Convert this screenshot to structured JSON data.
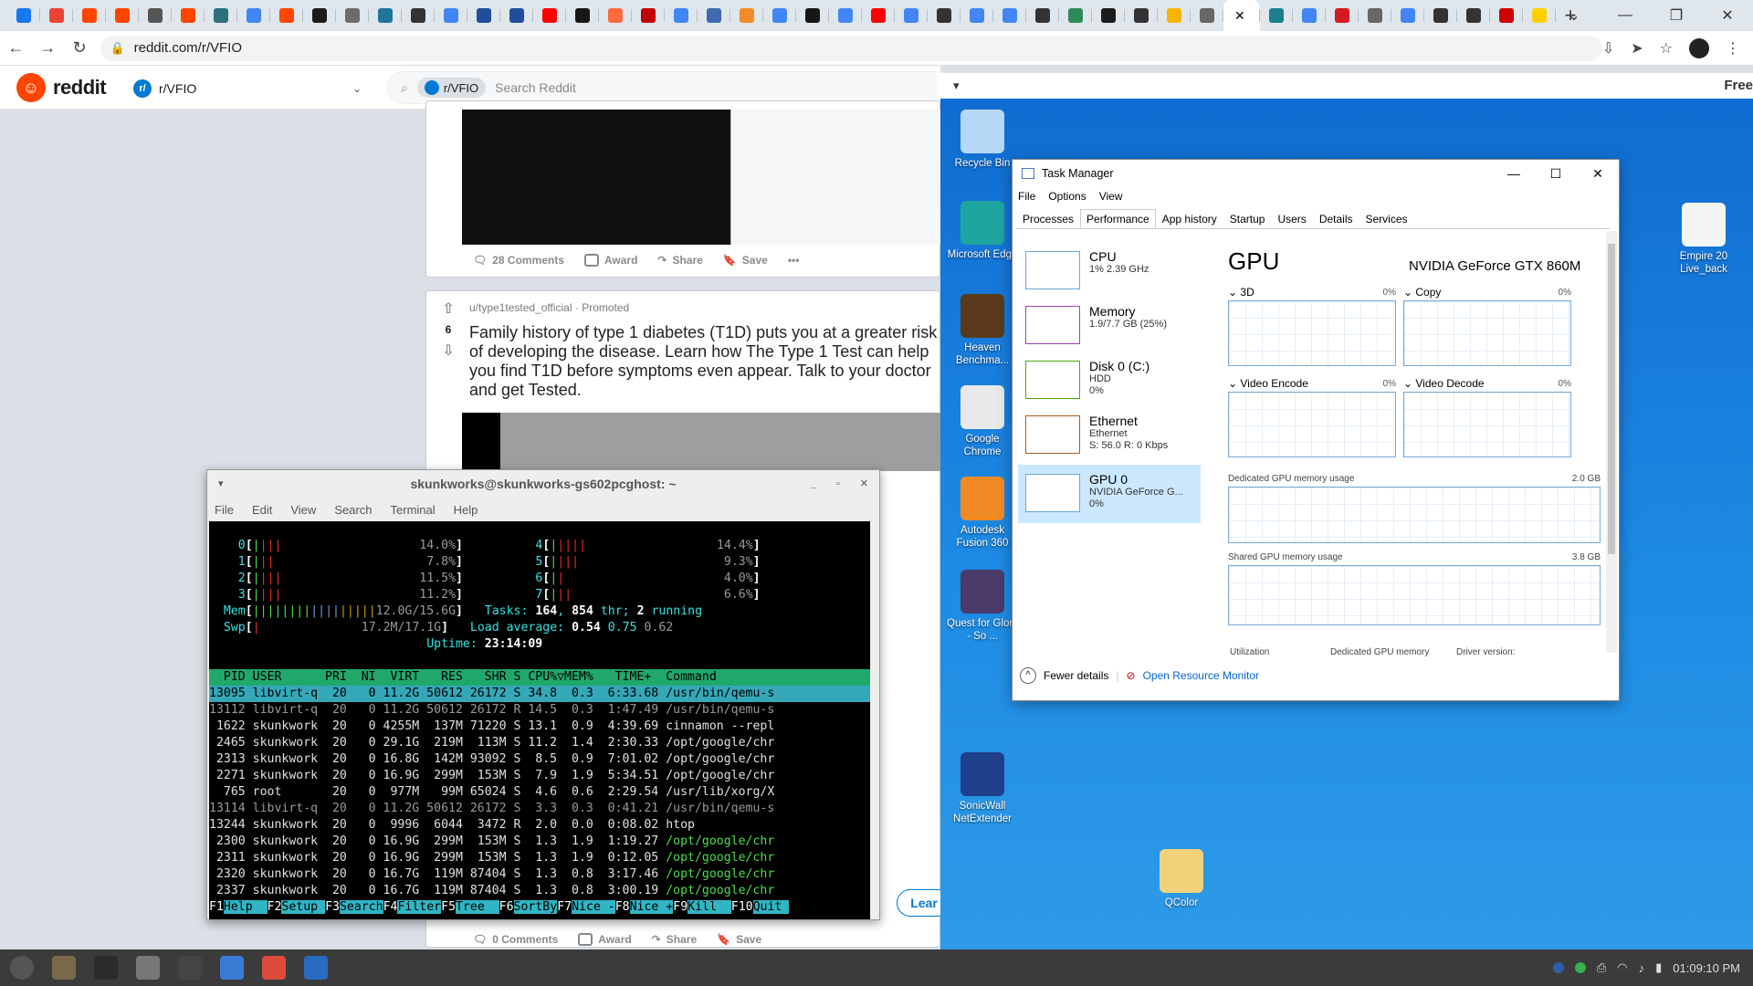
{
  "browser": {
    "tab_favicons": [
      "#1877f2",
      "#ea4335",
      "#ff4500",
      "#ff4500",
      "#555555",
      "#ff4500",
      "#2f6f7a",
      "#4285f4",
      "#ff4500",
      "#1c1c1c",
      "#6c6c6c",
      "#21759b",
      "#333333",
      "#4285f4",
      "#1f4e9c",
      "#1f4e9c",
      "#ff0000",
      "#181717",
      "#ff6a3d",
      "#c00000",
      "#4285f4",
      "#3f6ab1",
      "#f28c28",
      "#4285f4",
      "#181717",
      "#4285f4",
      "#ff0000",
      "#4285f4",
      "#333333",
      "#4285f4",
      "#4285f4",
      "#333333",
      "#2e8b57",
      "#1c1c1c",
      "#333333",
      "#f7b500",
      "#666666",
      "#ffffff",
      "#1a7f8e",
      "#4285f4",
      "#d71920",
      "#666666",
      "#4285f4",
      "#333333",
      "#333333",
      "#d00000",
      "#ffd000"
    ],
    "url": "reddit.com/r/VFIO",
    "new_tab": "+"
  },
  "reddit": {
    "logo_text": "reddit",
    "community": "r/VFIO",
    "search_chip": "r/VFIO",
    "search_placeholder": "Search Reddit",
    "post1": {
      "comments": "28 Comments",
      "award": "Award",
      "share": "Share",
      "save": "Save"
    },
    "post2": {
      "votes": "6",
      "author": "u/type1tested_official",
      "promoted": "Promoted",
      "title": "Family history of type 1 diabetes (T1D) puts you at a greater risk of developing the disease. Learn how The Type 1 Test can help you find T1D before symptoms even appear. Talk to your doctor and get Tested.",
      "learn": "Lear",
      "comments": "0 Comments",
      "award": "Award",
      "share": "Share",
      "save": "Save"
    }
  },
  "vm": {
    "title_right": "Free",
    "desktop_icons": [
      {
        "label": "Recycle Bin",
        "color": "#b6d7f5"
      },
      {
        "label": "Microsoft Edge",
        "color": "#1fa5a0"
      },
      {
        "label": "Heaven Benchma...",
        "color": "#5a3a1a"
      },
      {
        "label": "Google Chrome",
        "color": "#e9e9e9"
      },
      {
        "label": "Autodesk Fusion 360",
        "color": "#f08a24"
      },
      {
        "label": "Quest for Glory - So ...",
        "color": "#4a3b6b"
      },
      {
        "label": "SonicWall NetExtender",
        "color": "#1e3f8a"
      },
      {
        "label": "QColor",
        "color": "#f1d27a"
      },
      {
        "label": "Empire 20 Live_back",
        "color": "#f5f5f5"
      }
    ]
  },
  "taskmanager": {
    "title": "Task Manager",
    "menu": [
      "File",
      "Options",
      "View"
    ],
    "tabs": [
      "Processes",
      "Performance",
      "App history",
      "Startup",
      "Users",
      "Details",
      "Services"
    ],
    "perf_items": [
      {
        "name": "CPU",
        "line1": "1% 2.39 GHz",
        "line2": ""
      },
      {
        "name": "Memory",
        "line1": "1.9/7.7 GB (25%)",
        "line2": ""
      },
      {
        "name": "Disk 0 (C:)",
        "line1": "HDD",
        "line2": "0%"
      },
      {
        "name": "Ethernet",
        "line1": "Ethernet",
        "line2": "S: 56.0  R: 0 Kbps"
      },
      {
        "name": "GPU 0",
        "line1": "NVIDIA GeForce G...",
        "line2": "0%"
      }
    ],
    "gpu_title": "GPU",
    "gpu_model": "NVIDIA GeForce GTX 860M",
    "engines": [
      {
        "name": "3D",
        "pct": "0%"
      },
      {
        "name": "Copy",
        "pct": "0%"
      },
      {
        "name": "Video Encode",
        "pct": "0%"
      },
      {
        "name": "Video Decode",
        "pct": "0%"
      }
    ],
    "dedicated_label": "Dedicated GPU memory usage",
    "dedicated_max": "2.0 GB",
    "shared_label": "Shared GPU memory usage",
    "shared_max": "3.8 GB",
    "bottom_labels": [
      "Utilization",
      "Dedicated GPU memory",
      "Driver version:"
    ],
    "fewer_details": "Fewer details",
    "open_rm": "Open Resource Monitor"
  },
  "terminal": {
    "title": "skunkworks@skunkworks-gs602pcghost: ~",
    "menu": [
      "File",
      "Edit",
      "View",
      "Search",
      "Terminal",
      "Help"
    ],
    "cpus_left": [
      {
        "id": "0",
        "bars": "||||",
        "pct": "14.0%"
      },
      {
        "id": "1",
        "bars": "|||",
        "pct": "7.8%"
      },
      {
        "id": "2",
        "bars": "||||",
        "pct": "11.5%"
      },
      {
        "id": "3",
        "bars": "||||",
        "pct": "11.2%"
      }
    ],
    "cpus_right": [
      {
        "id": "4",
        "bars": "|||||",
        "pct": "14.4%"
      },
      {
        "id": "5",
        "bars": "||||",
        "pct": "9.3%"
      },
      {
        "id": "6",
        "bars": "||",
        "pct": "4.0%"
      },
      {
        "id": "7",
        "bars": "|||",
        "pct": "6.6%"
      }
    ],
    "mem": "12.0G/15.6G",
    "swp": "17.2M/17.1G",
    "tasks": "164",
    "thr": "854",
    "running": "2",
    "load1": "0.54",
    "load5": "0.75",
    "load15": "0.62",
    "uptime": "23:14:09",
    "header": "  PID USER      PRI  NI  VIRT   RES   SHR S CPU%▽MEM%   TIME+  Command",
    "rows": [
      "13095 libvirt-q  20   0 11.2G 50612 26172 S 34.8  0.3  6:33.68 /usr/bin/qemu-s",
      "13112 libvirt-q  20   0 11.2G 50612 26172 R 14.5  0.3  1:47.49 /usr/bin/qemu-s",
      " 1622 skunkwork  20   0 4255M  137M 71220 S 13.1  0.9  4:39.69 cinnamon --repl",
      " 2465 skunkwork  20   0 29.1G  219M  113M S 11.2  1.4  2:30.33 /opt/google/chr",
      " 2313 skunkwork  20   0 16.8G  142M 93092 S  8.5  0.9  7:01.02 /opt/google/chr",
      " 2271 skunkwork  20   0 16.9G  299M  153M S  7.9  1.9  5:34.51 /opt/google/chr",
      "  765 root       20   0  977M   99M 65024 S  4.6  0.6  2:29.54 /usr/lib/xorg/X",
      "13114 libvirt-q  20   0 11.2G 50612 26172 S  3.3  0.3  0:41.21 /usr/bin/qemu-s",
      "13244 skunkwork  20   0  9996  6044  3472 R  2.0  0.0  0:08.02 htop",
      " 2300 skunkwork  20   0 16.9G  299M  153M S  1.3  1.9  1:19.27 /opt/google/chr",
      " 2311 skunkwork  20   0 16.9G  299M  153M S  1.3  1.9  0:12.05 /opt/google/chr",
      " 2320 skunkwork  20   0 16.7G  119M 87404 S  1.3  0.8  3:17.46 /opt/google/chr",
      " 2337 skunkwork  20   0 16.7G  119M 87404 S  1.3  0.8  3:00.19 /opt/google/chr"
    ],
    "fkeys": [
      {
        "k": "F1",
        "l": "Help  "
      },
      {
        "k": "F2",
        "l": "Setup "
      },
      {
        "k": "F3",
        "l": "Search"
      },
      {
        "k": "F4",
        "l": "Filter"
      },
      {
        "k": "F5",
        "l": "Tree  "
      },
      {
        "k": "F6",
        "l": "SortBy"
      },
      {
        "k": "F7",
        "l": "Nice -"
      },
      {
        "k": "F8",
        "l": "Nice +"
      },
      {
        "k": "F9",
        "l": "Kill  "
      },
      {
        "k": "F10",
        "l": "Quit "
      }
    ]
  },
  "taskbar": {
    "apps": [
      "#555555",
      "#7a6a4a",
      "#2b2b2b",
      "#777777",
      "#444444",
      "#3a7bd5",
      "#dd4b39",
      "#2a6bc2"
    ],
    "clock": "01:09:10 PM"
  }
}
